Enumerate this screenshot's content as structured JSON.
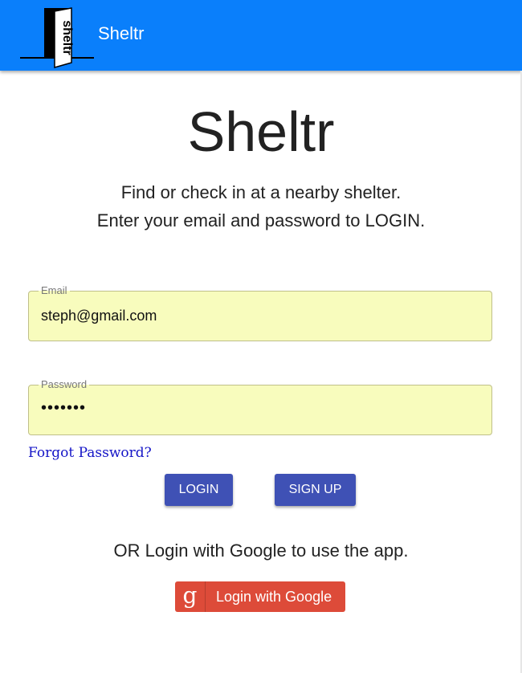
{
  "appbar": {
    "logo_text": "sheltr",
    "title": "Sheltr"
  },
  "hero": {
    "title": "Sheltr",
    "line1": "Find or check in at a nearby shelter.",
    "line2": "Enter your email and password to LOGIN."
  },
  "form": {
    "email_label": "Email",
    "email_value": "steph@gmail.com",
    "password_label": "Password",
    "password_value": "•••••••",
    "forgot_link": "Forgot Password?"
  },
  "actions": {
    "login_label": "LOGIN",
    "signup_label": "SIGN UP"
  },
  "google": {
    "prompt": "OR Login with Google to use the app.",
    "icon_glyph": "g",
    "button_label": "Login with Google"
  },
  "colors": {
    "appbar": "#0a7ffb",
    "primary_button": "#3f51b5",
    "google_button": "#dd4b39",
    "autofill_field": "#f8fcbd",
    "link": "#1515c7"
  },
  "icons": {
    "logo": "door-logo-icon",
    "google": "google-g-icon"
  }
}
